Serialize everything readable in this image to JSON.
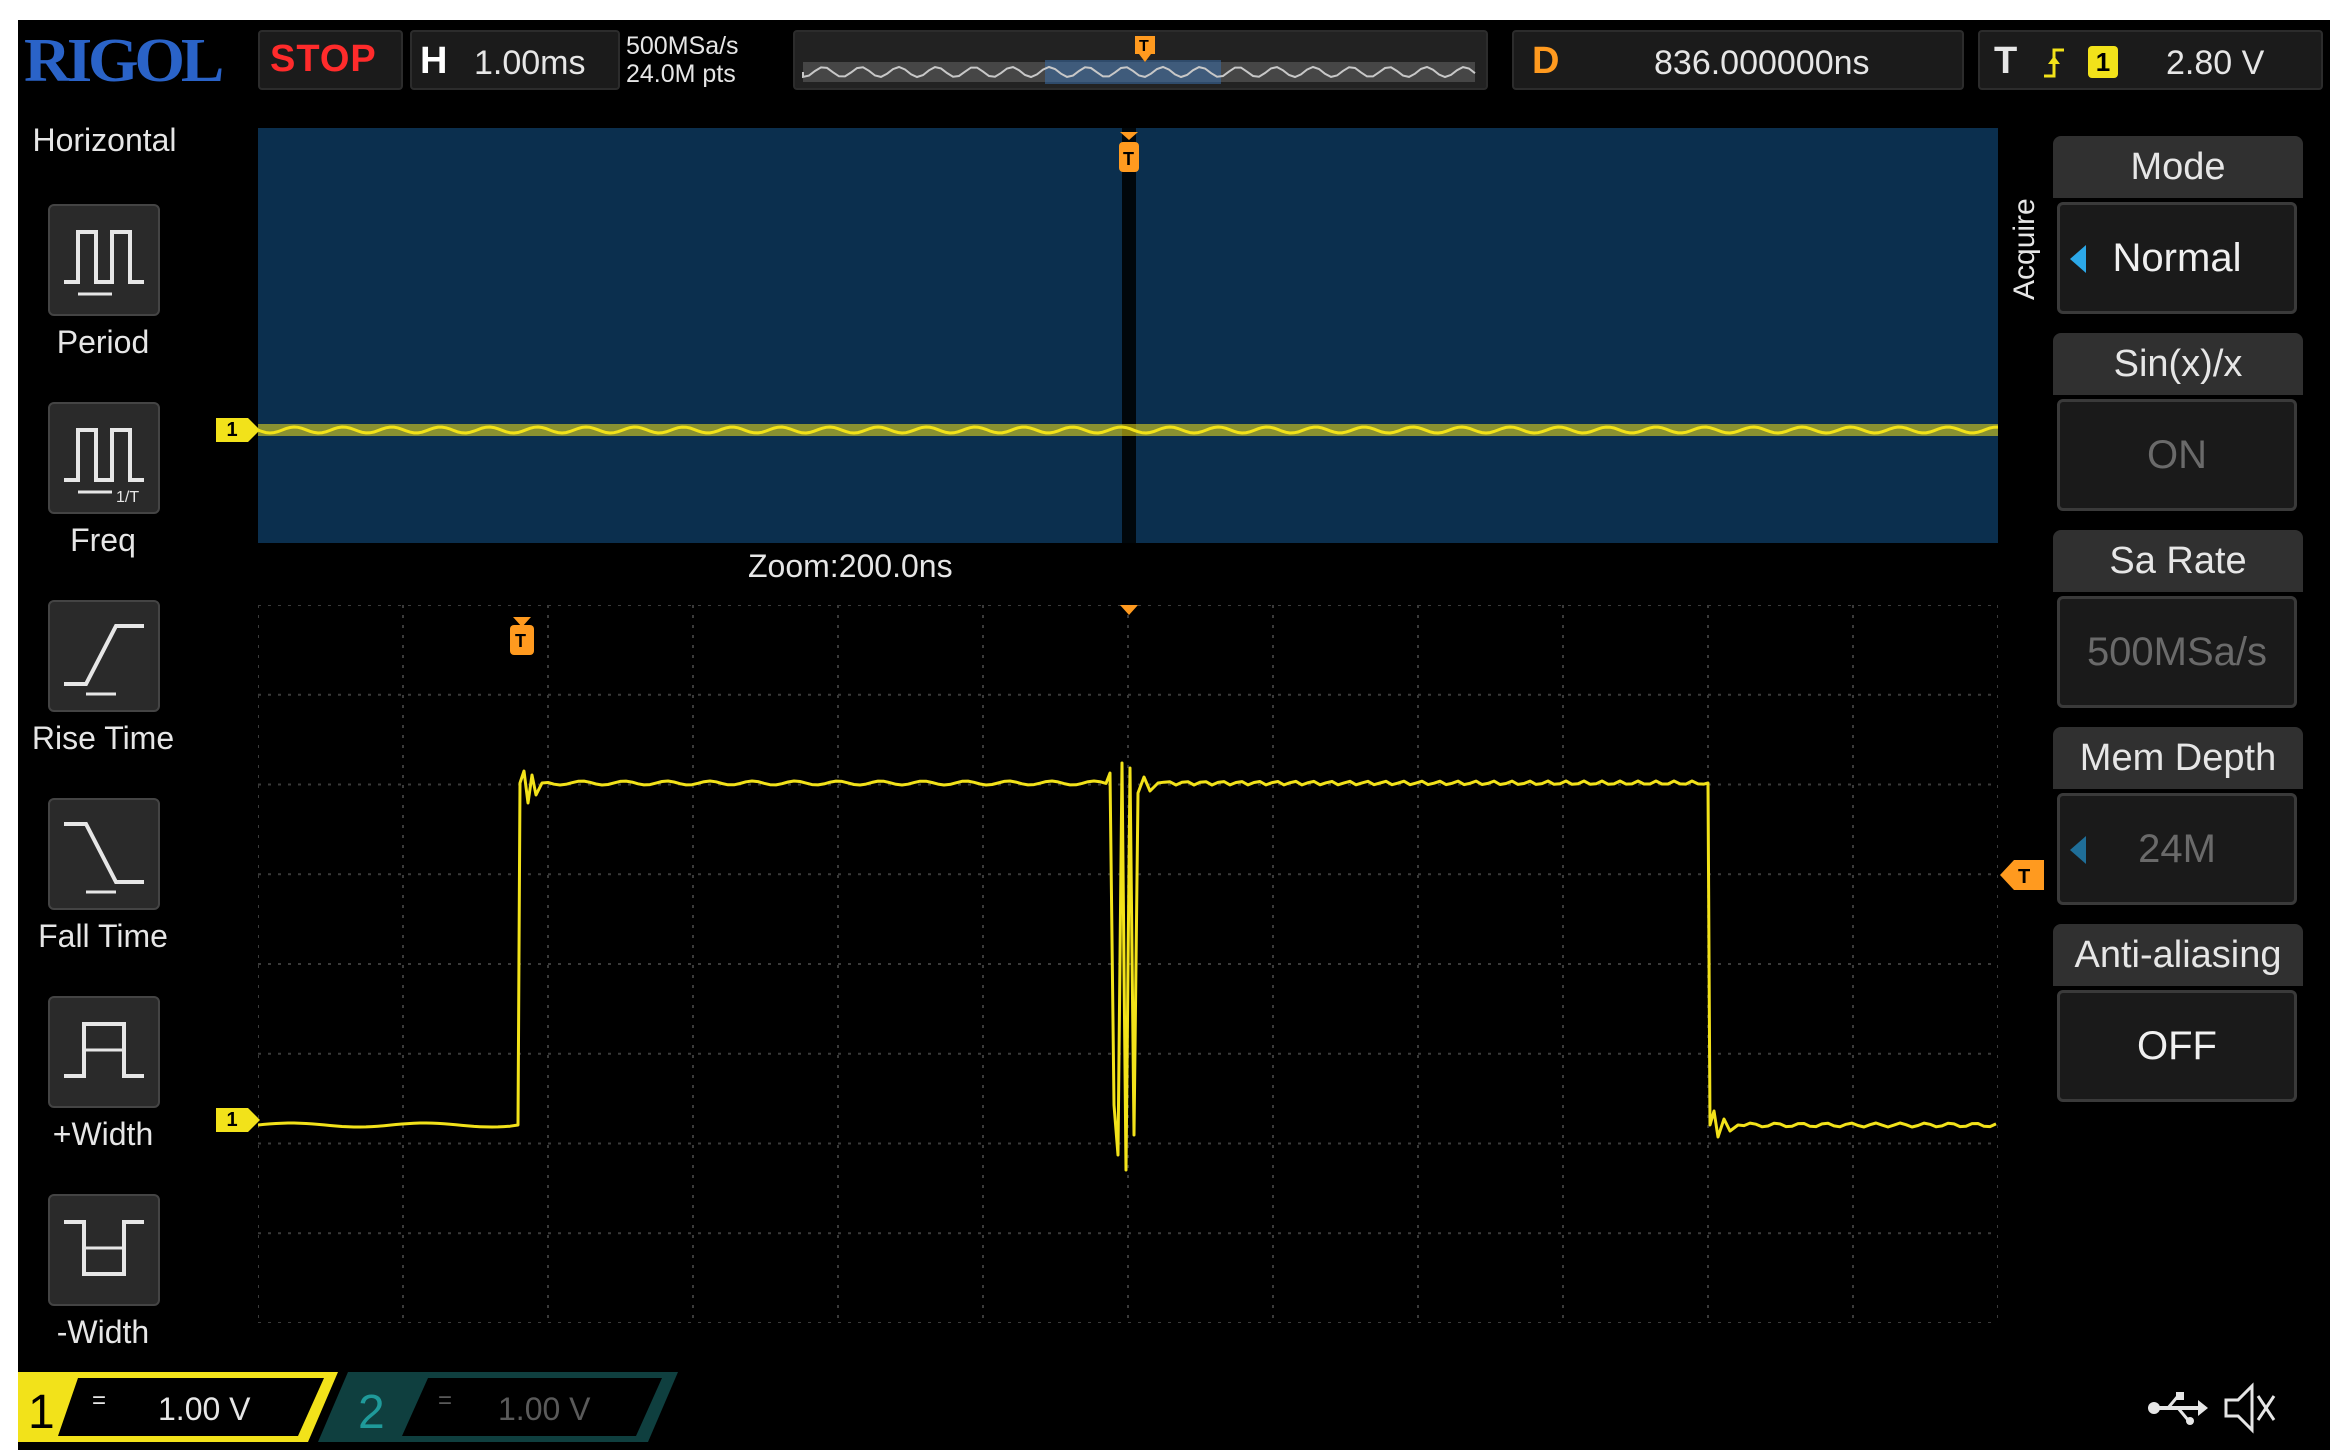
{
  "header": {
    "logo": "RIGOL",
    "run_state": "STOP",
    "timebase_label": "H",
    "timebase_value": "1.00ms",
    "sample_rate": "500MSa/s",
    "memory_points": "24.0M pts",
    "delay_label": "D",
    "delay_value": "836.000000ns",
    "trigger_label": "T",
    "trigger_channel": "1",
    "trigger_level": "2.80 V"
  },
  "horizontal_panel": {
    "title": "Horizontal",
    "items": [
      {
        "label": "Period",
        "icon": "period-icon"
      },
      {
        "label": "Freq",
        "icon": "frequency-icon"
      },
      {
        "label": "Rise Time",
        "icon": "rise-time-icon"
      },
      {
        "label": "Fall Time",
        "icon": "fall-time-icon"
      },
      {
        "label": "+Width",
        "icon": "positive-width-icon"
      },
      {
        "label": "-Width",
        "icon": "negative-width-icon"
      }
    ]
  },
  "waveform": {
    "zoom_label": "Zoom:200.0ns",
    "channel_marker": "1",
    "trigger_marker": "T"
  },
  "acquire_menu": {
    "title": "Acquire",
    "items": [
      {
        "header": "Mode",
        "value": "Normal"
      },
      {
        "header": "Sin(x)/x",
        "value": "ON"
      },
      {
        "header": "Sa Rate",
        "value": "500MSa/s"
      },
      {
        "header": "Mem Depth",
        "value": "24M"
      },
      {
        "header": "Anti-aliasing",
        "value": "OFF"
      }
    ]
  },
  "channels": [
    {
      "number": "1",
      "scale": "1.00 V",
      "color": "#f2e21a"
    },
    {
      "number": "2",
      "scale": "1.00 V",
      "color": "#1f9a9a"
    }
  ],
  "colors": {
    "ch1_trace": "#f2e21a",
    "trigger": "#ff9a1f",
    "stop": "#ff2b2b",
    "overview_bg": "#0b2f4e",
    "menu_arrow": "#2ca8e8"
  },
  "status_icons": [
    "usb-icon",
    "speaker-muted-icon"
  ]
}
